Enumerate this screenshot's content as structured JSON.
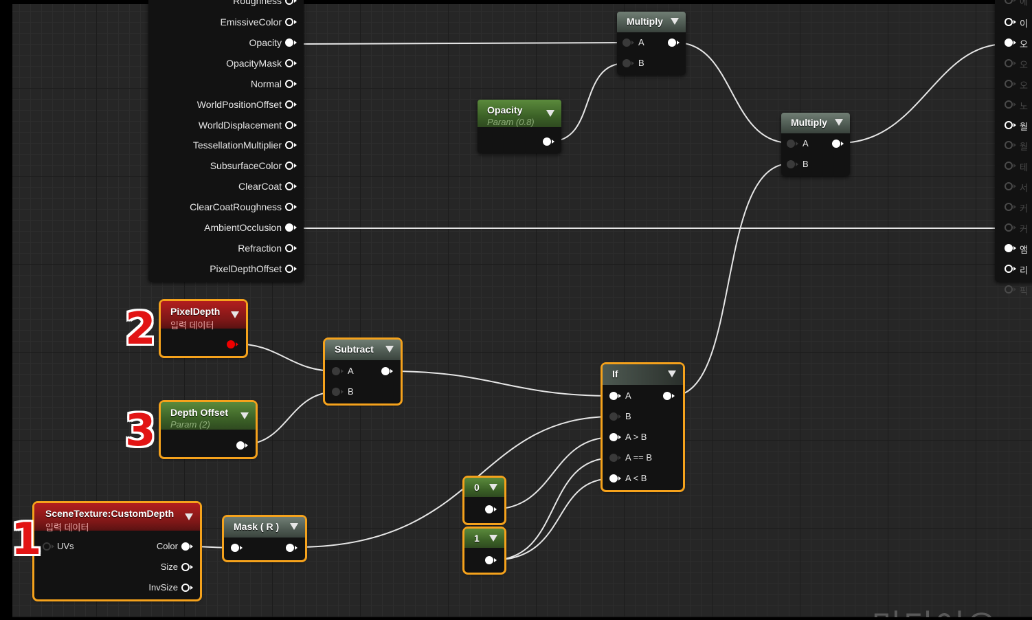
{
  "material_node": {
    "inputs": [
      "Roughness",
      "EmissiveColor",
      "Opacity",
      "OpacityMask",
      "Normal",
      "WorldPositionOffset",
      "WorldDisplacement",
      "TessellationMultiplier",
      "SubsurfaceColor",
      "ClearCoat",
      "ClearCoatRoughness",
      "AmbientOcclusion",
      "Refraction",
      "PixelDepthOffset"
    ]
  },
  "right_node": {
    "inputs": [
      "에",
      "이",
      "오",
      "오",
      "오",
      "노",
      "월",
      "월",
      "테",
      "서",
      "커",
      "커",
      "앰",
      "리",
      "픽"
    ]
  },
  "nodes": {
    "multiply1": {
      "title": "Multiply",
      "pin_a": "A",
      "pin_b": "B"
    },
    "multiply2": {
      "title": "Multiply",
      "pin_a": "A",
      "pin_b": "B"
    },
    "opacity_param": {
      "title": "Opacity",
      "subtitle": "Param (0.8)"
    },
    "pixel_depth": {
      "title": "PixelDepth",
      "subtitle": "입력 데이터"
    },
    "subtract": {
      "title": "Subtract",
      "pin_a": "A",
      "pin_b": "B"
    },
    "depth_offset": {
      "title": "Depth Offset",
      "subtitle": "Param (2)"
    },
    "if_node": {
      "title": "If",
      "pins": [
        "A",
        "B",
        "A > B",
        "A == B",
        "A < B"
      ]
    },
    "const0": {
      "title": "0"
    },
    "const1": {
      "title": "1"
    },
    "mask": {
      "title": "Mask ( R )"
    },
    "scene_texture": {
      "title": "SceneTexture:CustomDepth",
      "subtitle": "입력 데이터",
      "in_pin": "UVs",
      "out_pins": [
        "Color",
        "Size",
        "InvSize"
      ]
    }
  },
  "annotations": [
    "1",
    "2",
    "3"
  ],
  "watermark": "미디어오",
  "colors": {
    "selection": "#f5a21c",
    "param_header": "#3c6227",
    "math_header": "#4e5a52",
    "input_header": "#7c1717",
    "annotation_red": "#e21414",
    "wire": "#e6e6e6"
  }
}
